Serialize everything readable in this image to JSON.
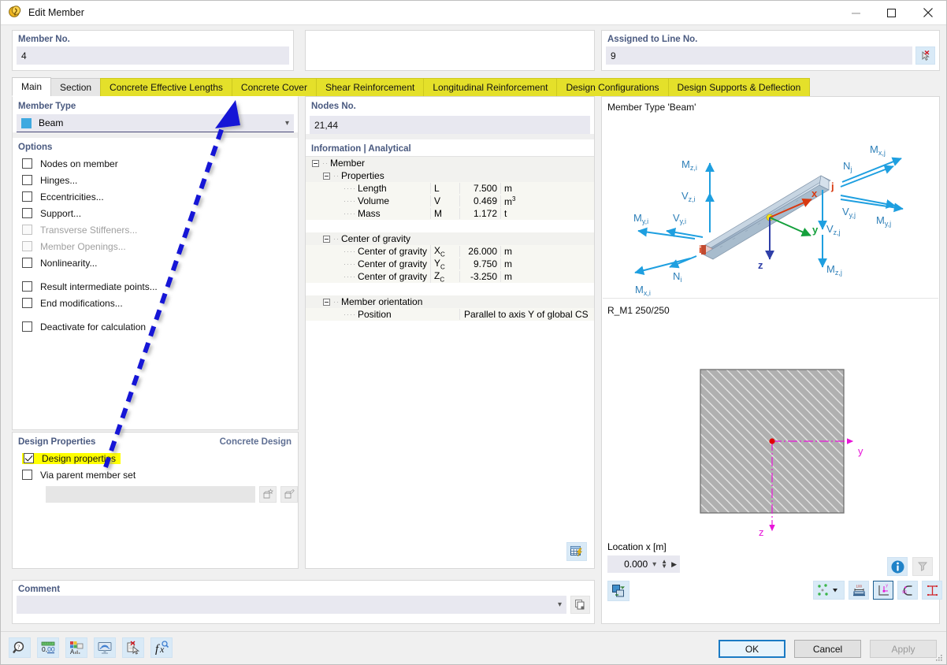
{
  "window": {
    "title": "Edit Member",
    "icon": "member-icon",
    "minimize_label": "—",
    "maximize_label": "☐",
    "close_label": "✕"
  },
  "top": {
    "member_no_label": "Member No.",
    "member_no_value": "4",
    "line_no_label": "Assigned to Line No.",
    "line_no_value": "9",
    "pick_line_icon": "pick-line-icon"
  },
  "tabs": [
    {
      "label": "Main",
      "state": "active"
    },
    {
      "label": "Section",
      "state": "normal"
    },
    {
      "label": "Concrete Effective Lengths",
      "state": "highlighted"
    },
    {
      "label": "Concrete Cover",
      "state": "highlighted"
    },
    {
      "label": "Shear Reinforcement",
      "state": "highlighted"
    },
    {
      "label": "Longitudinal Reinforcement",
      "state": "highlighted"
    },
    {
      "label": "Design Configurations",
      "state": "highlighted"
    },
    {
      "label": "Design Supports & Deflection",
      "state": "highlighted"
    }
  ],
  "left": {
    "member_type_label": "Member Type",
    "member_type_value": "Beam",
    "member_type_swatch": "#3fa9e0",
    "options_label": "Options",
    "options": [
      {
        "label": "Nodes on member",
        "checked": false,
        "disabled": false,
        "gap": false
      },
      {
        "label": "Hinges...",
        "checked": false,
        "disabled": false,
        "gap": false
      },
      {
        "label": "Eccentricities...",
        "checked": false,
        "disabled": false,
        "gap": false
      },
      {
        "label": "Support...",
        "checked": false,
        "disabled": false,
        "gap": false
      },
      {
        "label": "Transverse Stiffeners...",
        "checked": false,
        "disabled": true,
        "gap": false
      },
      {
        "label": "Member Openings...",
        "checked": false,
        "disabled": true,
        "gap": false
      },
      {
        "label": "Nonlinearity...",
        "checked": false,
        "disabled": false,
        "gap": false
      },
      {
        "label": "Result intermediate points...",
        "checked": false,
        "disabled": false,
        "gap": true
      },
      {
        "label": "End modifications...",
        "checked": false,
        "disabled": false,
        "gap": false
      },
      {
        "label": "Deactivate for calculation",
        "checked": false,
        "disabled": false,
        "gap": true
      }
    ],
    "design_properties_label": "Design Properties",
    "design_properties_right": "Concrete Design",
    "design_properties_checkbox": "Design properties",
    "design_properties_checked": true,
    "design_properties_highlight": "#ffff00",
    "via_parent_label": "Via parent member set",
    "via_parent_checked": false,
    "parent_input_value": "",
    "parent_new_icon": "new-member-set-icon",
    "parent_edit_icon": "edit-member-set-icon"
  },
  "middle": {
    "nodes_label": "Nodes No.",
    "nodes_value": "21,44",
    "info_header": "Information | Analytical",
    "root": "Member",
    "groups": [
      {
        "name": "Properties",
        "rows": [
          {
            "name": "Length",
            "symbol": "L",
            "value": "7.500",
            "unit": "m",
            "unit_sup": ""
          },
          {
            "name": "Volume",
            "symbol": "V",
            "value": "0.469",
            "unit": "m",
            "unit_sup": "3"
          },
          {
            "name": "Mass",
            "symbol": "M",
            "value": "1.172",
            "unit": "t",
            "unit_sup": ""
          }
        ]
      },
      {
        "name": "Center of gravity",
        "rows": [
          {
            "name": "Center of gravity",
            "symbol": "X",
            "symbol_sub": "C",
            "value": "26.000",
            "unit": "m",
            "unit_sup": ""
          },
          {
            "name": "Center of gravity",
            "symbol": "Y",
            "symbol_sub": "C",
            "value": "9.750",
            "unit": "m",
            "unit_sup": ""
          },
          {
            "name": "Center of gravity",
            "symbol": "Z",
            "symbol_sub": "C",
            "value": "-3.250",
            "unit": "m",
            "unit_sup": ""
          }
        ]
      },
      {
        "name": "Member orientation",
        "rows": [
          {
            "name": "Position",
            "symbol": "",
            "value": "Parallel to axis Y of global CS",
            "unit": "",
            "wide": true
          }
        ]
      }
    ],
    "table_tool_icon": "results-table-icon"
  },
  "right": {
    "member_type_caption": "Member Type 'Beam'",
    "section_caption": "R_M1 250/250",
    "location_label": "Location x [m]",
    "location_value": "0.000",
    "info_icon": "info-icon",
    "filter_icon": "filter-icon",
    "diagram": {
      "labels_start": [
        "M z,i",
        "V z,i",
        "M y,i",
        "V y,i",
        "N i",
        "M x,i"
      ],
      "labels_end": [
        "M x,j",
        "N j",
        "V y,j",
        "M y,j",
        "V z,j",
        "M z,j"
      ],
      "axes": [
        "x",
        "y",
        "z"
      ],
      "node_start": "i",
      "node_end": "j"
    },
    "section_axes": {
      "y": "y",
      "z": "z"
    },
    "toolbar": [
      {
        "icon": "nodes-display-icon",
        "state": "on",
        "dropdown": true
      },
      {
        "icon": "dimensions-icon",
        "state": "on",
        "dropdown": false
      },
      {
        "icon": "local-axes-icon",
        "state": "selected",
        "dropdown": false
      },
      {
        "icon": "shear-center-icon",
        "state": "on",
        "dropdown": false
      },
      {
        "icon": "section-dims-icon",
        "state": "on",
        "dropdown": false
      },
      {
        "icon": "stress-points-icon",
        "state": "off",
        "dropdown": false
      },
      {
        "icon": "numbering-icon",
        "state": "off",
        "dropdown": false
      },
      {
        "icon": "grid-icon",
        "state": "on",
        "dropdown": false
      },
      {
        "icon": "parts-list-icon",
        "state": "off",
        "dropdown": false
      },
      {
        "icon": "print-icon",
        "state": "on",
        "dropdown": true
      },
      {
        "icon": "reset-zoom-icon",
        "state": "on",
        "dropdown": false
      }
    ],
    "render_mode_icon": "render-mode-icon"
  },
  "comment": {
    "label": "Comment",
    "value": "",
    "copy_icon": "copy-icon"
  },
  "bottom": {
    "icons": [
      "zoom-info-icon",
      "units-icon",
      "display-properties-icon",
      "visibility-icon",
      "select-objects-icon",
      "formula-icon"
    ],
    "ok": "OK",
    "cancel": "Cancel",
    "apply": "Apply"
  },
  "annotation": {
    "arrow_color": "#1212d6",
    "description": "dashed-arrow-pointing-to-concrete-effective-lengths-tab"
  }
}
